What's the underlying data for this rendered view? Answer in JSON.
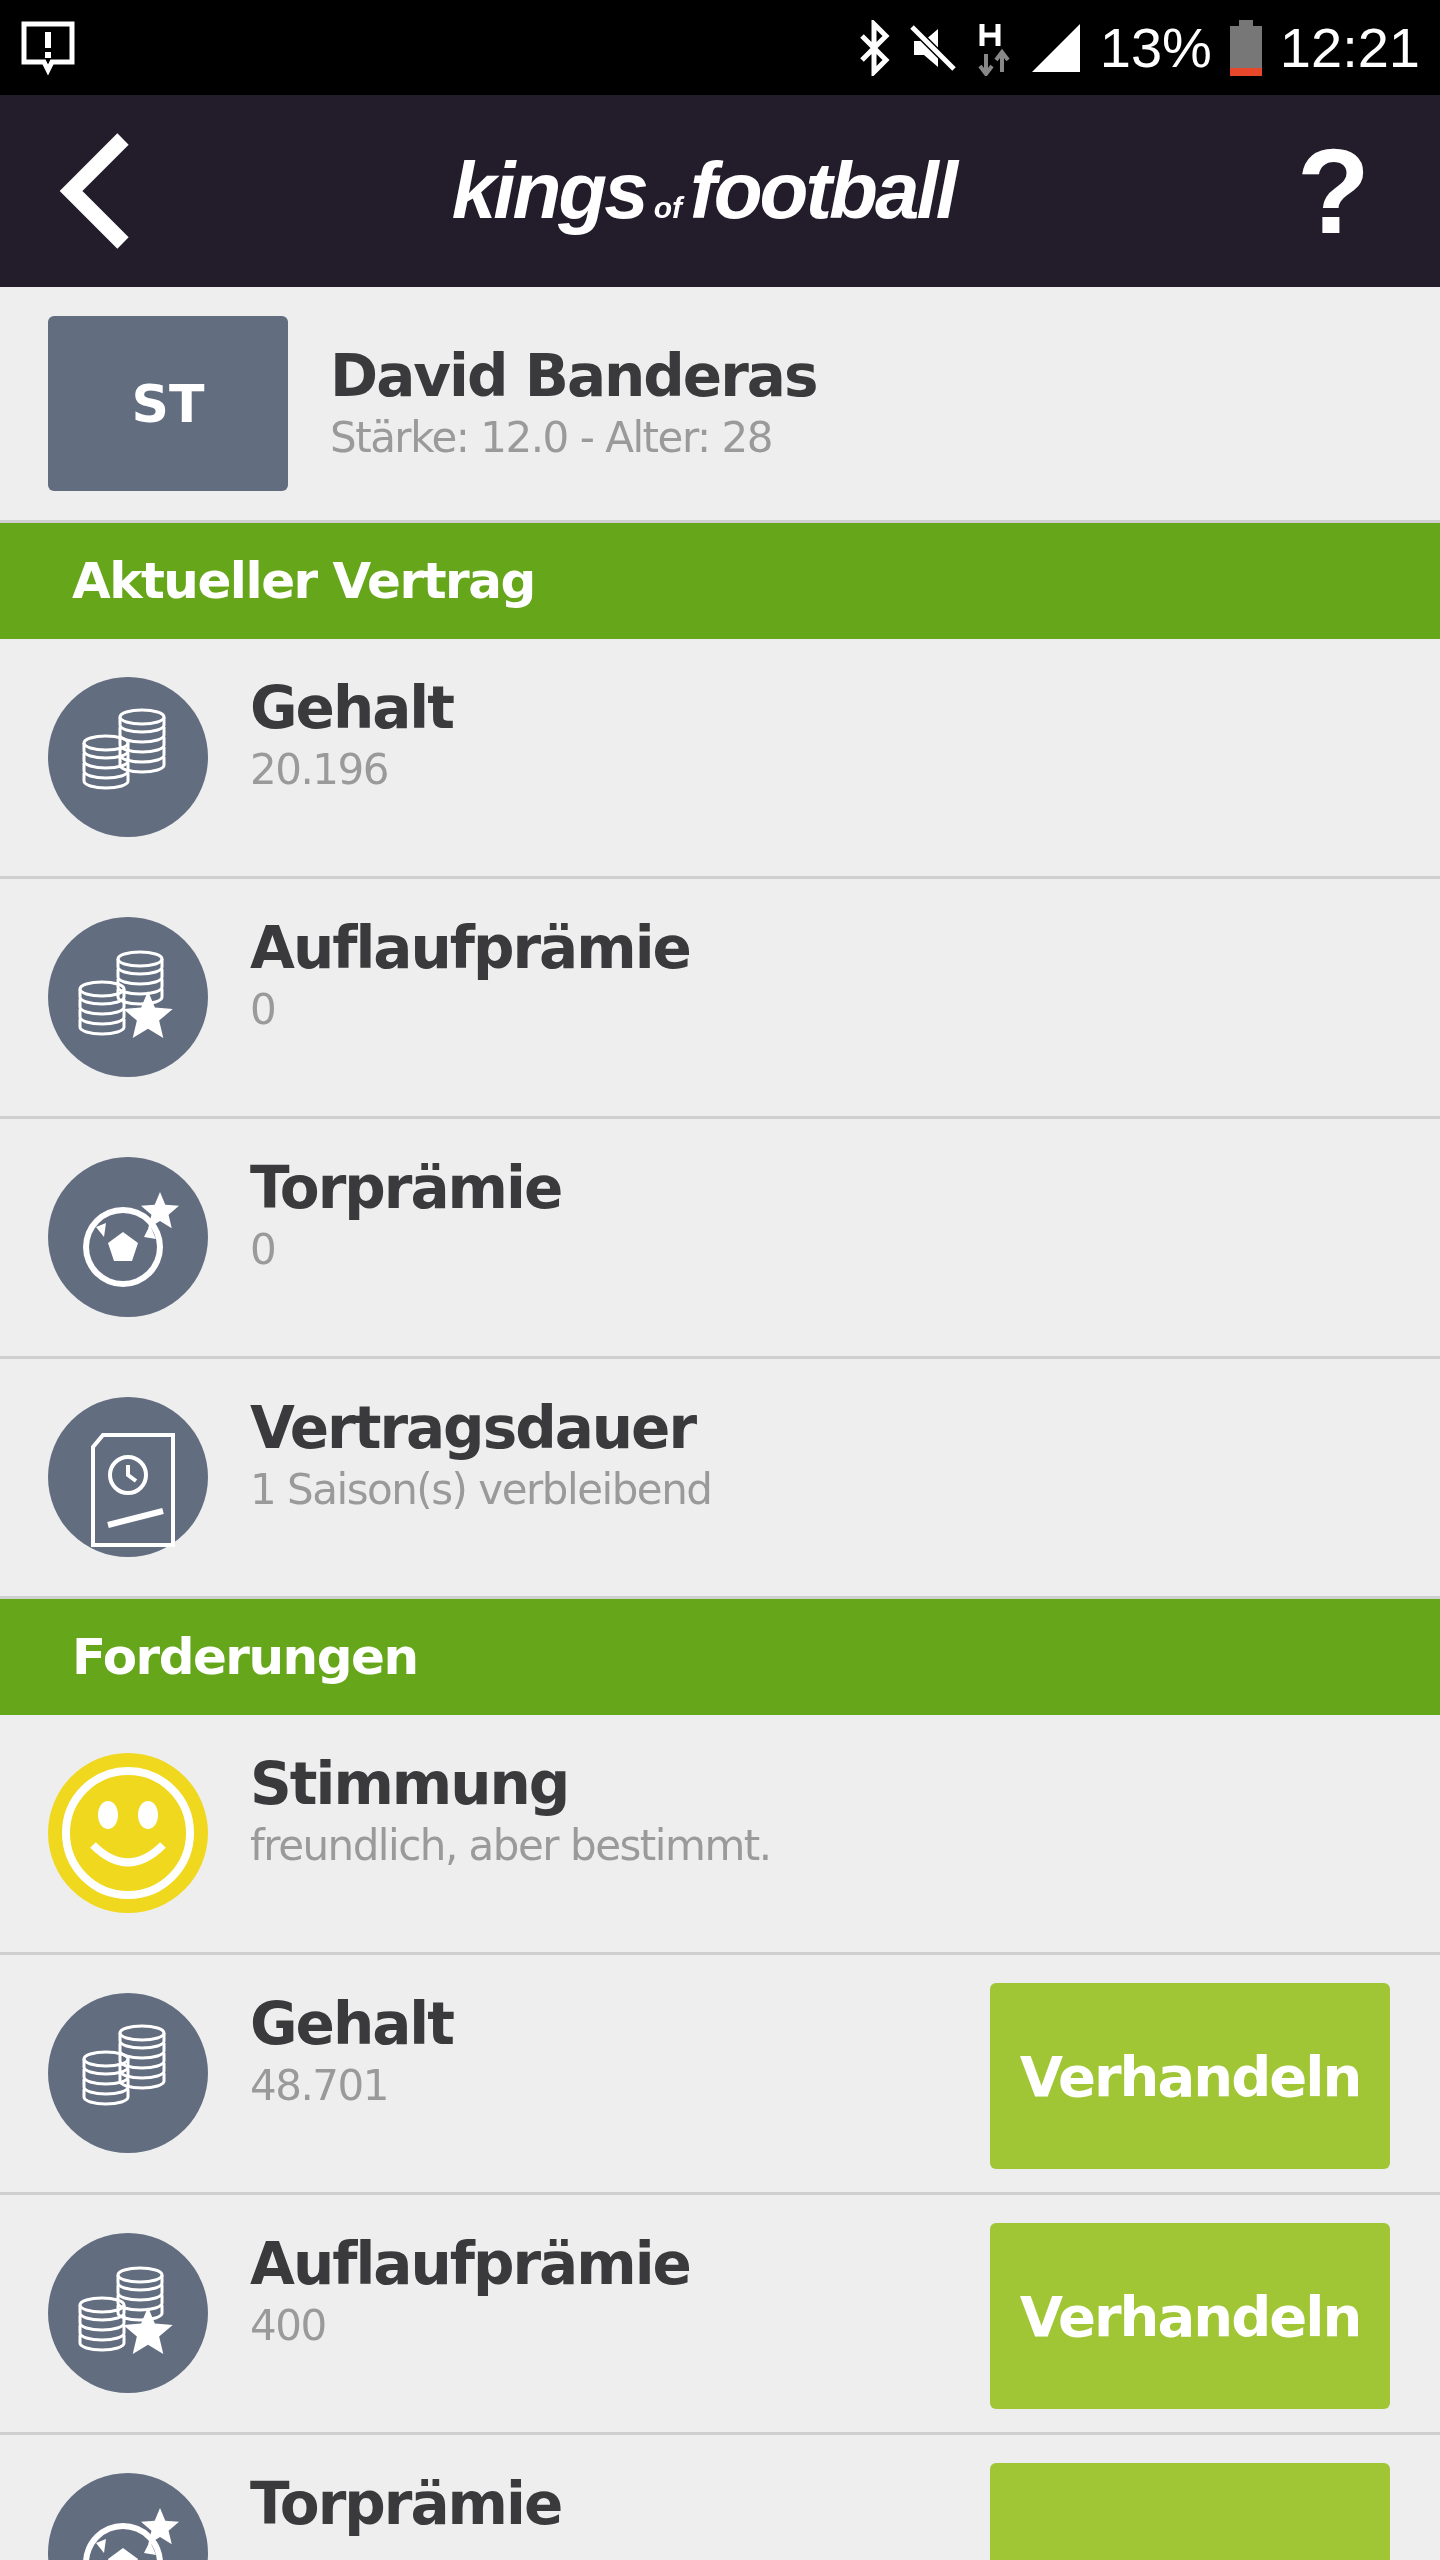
{
  "status_bar": {
    "battery": "13%",
    "time": "12:21"
  },
  "header": {
    "logo": [
      "kings",
      "of",
      "football"
    ],
    "help": "?"
  },
  "player": {
    "position": "ST",
    "name": "David Banderas",
    "details": "Stärke: 12.0 - Alter: 28"
  },
  "sections": [
    {
      "title": "Aktueller Vertrag",
      "rows": [
        {
          "kind": "coins",
          "title": "Gehalt",
          "value": "20.196"
        },
        {
          "kind": "coins-star",
          "title": "Auflaufprämie",
          "value": "0"
        },
        {
          "kind": "ball-star",
          "title": "Torprämie",
          "value": "0"
        },
        {
          "kind": "contract",
          "title": "Vertragsdauer",
          "value": "1 Saison(s) verbleibend"
        }
      ]
    },
    {
      "title": "Forderungen",
      "rows": [
        {
          "kind": "smiley",
          "title": "Stimmung",
          "value": "freundlich, aber bestimmt.",
          "negotiable": false
        },
        {
          "kind": "coins",
          "title": "Gehalt",
          "value": "48.701",
          "negotiable": true,
          "action": "Verhandeln"
        },
        {
          "kind": "coins-star",
          "title": "Auflaufprämie",
          "value": "400",
          "negotiable": true,
          "action": "Verhandeln"
        },
        {
          "kind": "ball-star",
          "title": "Torprämie",
          "negotiable": true
        }
      ]
    }
  ]
}
